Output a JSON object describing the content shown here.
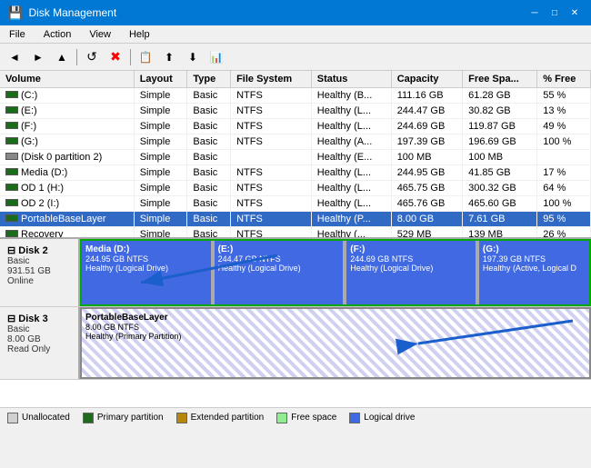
{
  "window": {
    "title": "Disk Management"
  },
  "menu": {
    "items": [
      "File",
      "Action",
      "View",
      "Help"
    ]
  },
  "toolbar": {
    "buttons": [
      "◄",
      "►",
      "▲",
      "◄",
      "✖",
      "📋",
      "↑",
      "↓",
      "📊"
    ]
  },
  "columns": [
    "Volume",
    "Layout",
    "Type",
    "File System",
    "Status",
    "Capacity",
    "Free Spa...",
    "% Free"
  ],
  "volumes": [
    {
      "name": "(C:)",
      "layout": "Simple",
      "type": "Basic",
      "fs": "NTFS",
      "status": "Healthy (B...",
      "capacity": "111.16 GB",
      "free": "61.28 GB",
      "pct": "55 %"
    },
    {
      "name": "(E:)",
      "layout": "Simple",
      "type": "Basic",
      "fs": "NTFS",
      "status": "Healthy (L...",
      "capacity": "244.47 GB",
      "free": "30.82 GB",
      "pct": "13 %"
    },
    {
      "name": "(F:)",
      "layout": "Simple",
      "type": "Basic",
      "fs": "NTFS",
      "status": "Healthy (L...",
      "capacity": "244.69 GB",
      "free": "119.87 GB",
      "pct": "49 %"
    },
    {
      "name": "(G:)",
      "layout": "Simple",
      "type": "Basic",
      "fs": "NTFS",
      "status": "Healthy (A...",
      "capacity": "197.39 GB",
      "free": "196.69 GB",
      "pct": "100 %"
    },
    {
      "name": "(Disk 0 partition 2)",
      "layout": "Simple",
      "type": "Basic",
      "fs": "",
      "status": "Healthy (E...",
      "capacity": "100 MB",
      "free": "100 MB",
      "pct": ""
    },
    {
      "name": "Media (D:)",
      "layout": "Simple",
      "type": "Basic",
      "fs": "NTFS",
      "status": "Healthy (L...",
      "capacity": "244.95 GB",
      "free": "41.85 GB",
      "pct": "17 %"
    },
    {
      "name": "OD 1 (H:)",
      "layout": "Simple",
      "type": "Basic",
      "fs": "NTFS",
      "status": "Healthy (L...",
      "capacity": "465.75 GB",
      "free": "300.32 GB",
      "pct": "64 %"
    },
    {
      "name": "OD 2 (I:)",
      "layout": "Simple",
      "type": "Basic",
      "fs": "NTFS",
      "status": "Healthy (L...",
      "capacity": "465.76 GB",
      "free": "465.60 GB",
      "pct": "100 %"
    },
    {
      "name": "PortableBaseLayer",
      "layout": "Simple",
      "type": "Basic",
      "fs": "NTFS",
      "status": "Healthy (P...",
      "capacity": "8.00 GB",
      "free": "7.61 GB",
      "pct": "95 %"
    },
    {
      "name": "Recovery",
      "layout": "Simple",
      "type": "Basic",
      "fs": "NTFS",
      "status": "Healthy (...",
      "capacity": "529 MB",
      "free": "139 MB",
      "pct": "26 %"
    }
  ],
  "disks": [
    {
      "name": "Disk 2",
      "type": "Basic",
      "size": "931.51 GB",
      "status": "Online",
      "partitions": [
        {
          "name": "Media (D:)",
          "size": "244.95 GB NTFS",
          "health": "Healthy (Logical Drive)",
          "type": "logical"
        },
        {
          "name": "(E:)",
          "size": "244.47 GB NTFS",
          "health": "Healthy (Logical Drive)",
          "type": "logical"
        },
        {
          "name": "(F:)",
          "size": "244.69 GB NTFS",
          "health": "Healthy (Logical Drive)",
          "type": "logical"
        },
        {
          "name": "(G:)",
          "size": "197.39 GB NTFS",
          "health": "Healthy (Active, Logical D",
          "type": "logical"
        }
      ]
    },
    {
      "name": "Disk 3",
      "type": "Basic",
      "size": "8.00 GB",
      "status": "Read Only",
      "partitions": [
        {
          "name": "PortableBaseLayer",
          "size": "8.00 GB NTFS",
          "health": "Healthy (Primary Partition)",
          "type": "primary"
        }
      ]
    }
  ],
  "legend": [
    {
      "label": "Unallocated",
      "color": "#d0d0d0"
    },
    {
      "label": "Primary partition",
      "color": "#4169e1"
    },
    {
      "label": "Extended partition",
      "color": "#b8860b"
    },
    {
      "label": "Free space",
      "color": "#90ee90"
    },
    {
      "label": "Logical drive",
      "color": "#4169e1"
    }
  ]
}
